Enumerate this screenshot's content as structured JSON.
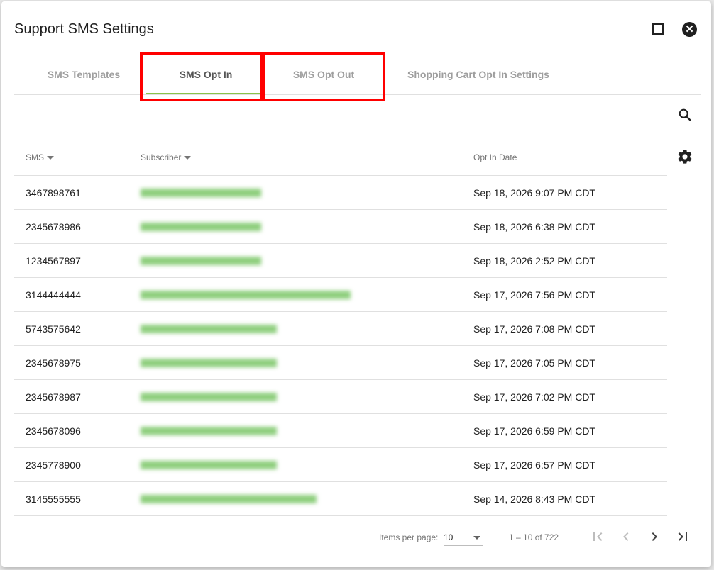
{
  "dialog": {
    "title": "Support SMS Settings"
  },
  "tabs": [
    {
      "label": "SMS Templates"
    },
    {
      "label": "SMS Opt In"
    },
    {
      "label": "SMS Opt Out"
    },
    {
      "label": "Shopping Cart Opt In Settings"
    }
  ],
  "active_tab": "SMS Opt In",
  "table": {
    "headers": {
      "sms": "SMS",
      "subscriber": "Subscriber",
      "opt_in_date": "Opt In Date"
    },
    "rows": [
      {
        "sms": "3467898761",
        "date": "Sep 18, 2026 9:07 PM CDT"
      },
      {
        "sms": "2345678986",
        "date": "Sep 18, 2026 6:38 PM CDT"
      },
      {
        "sms": "1234567897",
        "date": "Sep 18, 2026 2:52 PM CDT"
      },
      {
        "sms": "3144444444",
        "date": "Sep 17, 2026 7:56 PM CDT"
      },
      {
        "sms": "5743575642",
        "date": "Sep 17, 2026 7:08 PM CDT"
      },
      {
        "sms": "2345678975",
        "date": "Sep 17, 2026 7:05 PM CDT"
      },
      {
        "sms": "2345678987",
        "date": "Sep 17, 2026 7:02 PM CDT"
      },
      {
        "sms": "2345678096",
        "date": "Sep 17, 2026 6:59 PM CDT"
      },
      {
        "sms": "2345778900",
        "date": "Sep 17, 2026 6:57 PM CDT"
      },
      {
        "sms": "3145555555",
        "date": "Sep 14, 2026 8:43 PM CDT"
      }
    ]
  },
  "paginator": {
    "items_per_page_label": "Items per page:",
    "items_per_page_value": "10",
    "range_label": "1 – 10 of 722"
  },
  "colors": {
    "accent": "#8bc34a",
    "highlight": "#ff0000"
  },
  "icons": {
    "maximize": "square-icon",
    "close": "close-circle-icon",
    "search": "search-icon",
    "settings": "gear-icon",
    "first": "first-page-icon",
    "prev": "chevron-left-icon",
    "next": "chevron-right-icon",
    "last": "last-page-icon"
  }
}
